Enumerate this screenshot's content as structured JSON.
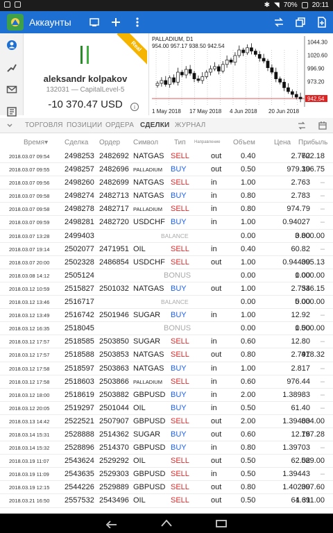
{
  "status": {
    "battery": "70%",
    "time": "20:11",
    "icons": [
      "alert-icon",
      "picture-icon",
      "bluetooth-icon",
      "wifi-icon",
      "battery-icon"
    ]
  },
  "app": {
    "title": "Аккаунты",
    "accent": "#1d6fd2"
  },
  "account": {
    "name": "aleksandr kolpakov",
    "subline": "132031 — CapitalLevel-5",
    "balance": "-10 370.47 USD",
    "badge": "Real"
  },
  "chart_data": {
    "type": "candlestick",
    "title": "PALLADIUM, D1",
    "ohlc_text": "954.00 957.17 938.50 942.54",
    "y_ticks": [
      "1044.30",
      "1020.60",
      "996.90",
      "973.20",
      "942.54"
    ],
    "ylim": [
      930,
      1050
    ],
    "x_ticks": [
      "1 May 2018",
      "17 May 2018",
      "4 Jun 2018",
      "20 Jun 2018"
    ],
    "current_price": 942.54,
    "approx_closes": [
      970,
      975,
      968,
      980,
      972,
      990,
      985,
      995,
      988,
      978,
      975,
      982,
      990,
      996,
      1000,
      992,
      1004,
      1012,
      1008,
      1020,
      1030,
      1025,
      1034,
      1028,
      1022,
      1015,
      1010,
      998,
      990,
      978,
      972,
      962,
      955,
      950,
      945,
      942
    ]
  },
  "tabs": [
    {
      "label": "ТОРГОВЛЯ",
      "active": false
    },
    {
      "label": "ПОЗИЦИИ",
      "active": false
    },
    {
      "label": "ОРДЕРА",
      "active": false
    },
    {
      "label": "СДЕЛКИ",
      "active": true
    },
    {
      "label": "ЖУРНАЛ",
      "active": false
    }
  ],
  "columns": {
    "time": "Время▾",
    "deal": "Сделка",
    "order": "Ордер",
    "symbol": "Символ",
    "type": "Тип",
    "direction": "Направление",
    "volume": "Объем",
    "price": "Цена",
    "profit": "Прибыль"
  },
  "rows": [
    {
      "time": "2018.03.07 09:54",
      "deal": "2498253",
      "order": "2482692",
      "symbol": "NATGAS",
      "type": "SELL",
      "dir": "out",
      "vol": "0.40",
      "price": "2.762",
      "profit": "702.18"
    },
    {
      "time": "2018.03.07 09:55",
      "deal": "2498257",
      "order": "2482696",
      "symbol": "PALLADIUM",
      "type": "BUY",
      "dir": "out",
      "vol": "0.50",
      "price": "979.10",
      "profit": "396.75"
    },
    {
      "time": "2018.03.07 09:56",
      "deal": "2498260",
      "order": "2482699",
      "symbol": "NATGAS",
      "type": "SELL",
      "dir": "in",
      "vol": "1.00",
      "price": "2.763",
      "profit": "–"
    },
    {
      "time": "2018.03.07 09:58",
      "deal": "2498274",
      "order": "2482713",
      "symbol": "NATGAS",
      "type": "BUY",
      "dir": "in",
      "vol": "0.80",
      "price": "2.783",
      "profit": "–"
    },
    {
      "time": "2018.03.07 09:58",
      "deal": "2498278",
      "order": "2482717",
      "symbol": "PALLADIUM",
      "type": "SELL",
      "dir": "in",
      "vol": "0.80",
      "price": "974.79",
      "profit": "–"
    },
    {
      "time": "2018.03.07 09:59",
      "deal": "2498281",
      "order": "2482720",
      "symbol": "USDCHF",
      "type": "BUY",
      "dir": "in",
      "vol": "1.00",
      "price": "0.94027",
      "profit": "–"
    },
    {
      "time": "2018.03.07 13:28",
      "deal": "2499403",
      "order": "",
      "symbol": "",
      "type": "BALANCE",
      "dir": "",
      "vol": "0.00",
      "price": "0.00",
      "profit": "3 800.00"
    },
    {
      "time": "2018.03.07 19:14",
      "deal": "2502077",
      "order": "2471951",
      "symbol": "OIL",
      "type": "SELL",
      "dir": "in",
      "vol": "0.40",
      "price": "60.82",
      "profit": "–"
    },
    {
      "time": "2018.03.07 20:00",
      "deal": "2502328",
      "order": "2486854",
      "symbol": "USDCHF",
      "type": "SELL",
      "dir": "out",
      "vol": "1.00",
      "price": "0.94400",
      "profit": "395.13"
    },
    {
      "time": "2018.03.08 14:12",
      "deal": "2505124",
      "order": "",
      "symbol": "",
      "type": "BONUS",
      "dir": "",
      "vol": "0.00",
      "price": "0.00",
      "profit": "1 000.00"
    },
    {
      "time": "2018.03.12 10:59",
      "deal": "2515827",
      "order": "2501032",
      "symbol": "NATGAS",
      "type": "BUY",
      "dir": "out",
      "vol": "1.00",
      "price": "2.754",
      "profit": "336.15"
    },
    {
      "time": "2018.03.12 13:46",
      "deal": "2516717",
      "order": "",
      "symbol": "",
      "type": "BALANCE",
      "dir": "",
      "vol": "0.00",
      "price": "0.00",
      "profit": "5 000.00"
    },
    {
      "time": "2018.03.12 13:49",
      "deal": "2516742",
      "order": "2501946",
      "symbol": "SUGAR",
      "type": "BUY",
      "dir": "in",
      "vol": "1.00",
      "price": "12.92",
      "profit": "–"
    },
    {
      "time": "2018.03.12 16:35",
      "deal": "2518045",
      "order": "",
      "symbol": "",
      "type": "BONUS",
      "dir": "",
      "vol": "0.00",
      "price": "0.00",
      "profit": "1 500.00"
    },
    {
      "time": "2018.03.12 17:57",
      "deal": "2518585",
      "order": "2503850",
      "symbol": "SUGAR",
      "type": "SELL",
      "dir": "in",
      "vol": "0.60",
      "price": "12.80",
      "profit": "–"
    },
    {
      "time": "2018.03.12 17:57",
      "deal": "2518588",
      "order": "2503853",
      "symbol": "NATGAS",
      "type": "SELL",
      "dir": "out",
      "vol": "0.80",
      "price": "2.797",
      "profit": "418.32"
    },
    {
      "time": "2018.03.12 17:58",
      "deal": "2518597",
      "order": "2503863",
      "symbol": "NATGAS",
      "type": "BUY",
      "dir": "in",
      "vol": "1.00",
      "price": "2.817",
      "profit": "–"
    },
    {
      "time": "2018.03.12 17:58",
      "deal": "2518603",
      "order": "2503866",
      "symbol": "PALLADIUM",
      "type": "SELL",
      "dir": "in",
      "vol": "0.60",
      "price": "976.44",
      "profit": "–"
    },
    {
      "time": "2018.03.12 18:00",
      "deal": "2518619",
      "order": "2503882",
      "symbol": "GBPUSD",
      "type": "BUY",
      "dir": "in",
      "vol": "2.00",
      "price": "1.38983",
      "profit": "–"
    },
    {
      "time": "2018.03.12 20:05",
      "deal": "2519297",
      "order": "2501044",
      "symbol": "OIL",
      "type": "BUY",
      "dir": "in",
      "vol": "0.50",
      "price": "61.40",
      "profit": "–"
    },
    {
      "time": "2018.03.13 14:42",
      "deal": "2522521",
      "order": "2507907",
      "symbol": "GBPUSD",
      "type": "SELL",
      "dir": "out",
      "vol": "2.00",
      "price": "1.39400",
      "profit": "834.00"
    },
    {
      "time": "2018.03.14 15:31",
      "deal": "2528888",
      "order": "2514362",
      "symbol": "SUGAR",
      "type": "BUY",
      "dir": "out",
      "vol": "0.60",
      "price": "12.76",
      "profit": "197.28"
    },
    {
      "time": "2018.03.14 15:32",
      "deal": "2528896",
      "order": "2514370",
      "symbol": "GBPUSD",
      "type": "BUY",
      "dir": "in",
      "vol": "0.80",
      "price": "1.39703",
      "profit": "–"
    },
    {
      "time": "2018.03.19 11:07",
      "deal": "2543624",
      "order": "2529292",
      "symbol": "OIL",
      "type": "SELL",
      "dir": "out",
      "vol": "0.50",
      "price": "62.02",
      "profit": "589.00"
    },
    {
      "time": "2018.03.19 11:09",
      "deal": "2543635",
      "order": "2529303",
      "symbol": "GBPUSD",
      "type": "SELL",
      "dir": "in",
      "vol": "0.50",
      "price": "1.39443",
      "profit": "–"
    },
    {
      "time": "2018.03.19 12:15",
      "deal": "2544226",
      "order": "2529889",
      "symbol": "GBPUSD",
      "type": "SELL",
      "dir": "out",
      "vol": "0.80",
      "price": "1.40200",
      "profit": "397.60"
    },
    {
      "time": "2018.03.21 16:50",
      "deal": "2557532",
      "order": "2543496",
      "symbol": "OIL",
      "type": "SELL",
      "dir": "out",
      "vol": "0.50",
      "price": "64.69",
      "profit": "1 311.00"
    }
  ]
}
